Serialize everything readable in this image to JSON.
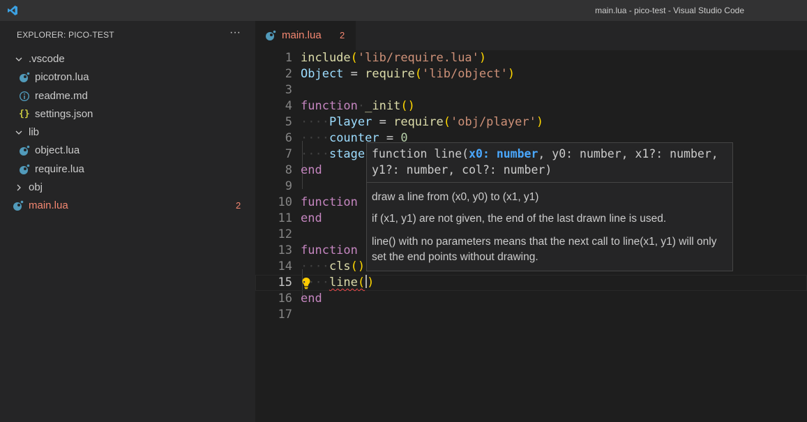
{
  "window": {
    "title": "main.lua - pico-test - Visual Studio Code"
  },
  "sidebar": {
    "header": "EXPLORER: PICO-TEST",
    "more_label": "···",
    "tree": [
      {
        "name": ".vscode",
        "kind": "folder",
        "expanded": true,
        "icon": "chevron-down-icon"
      },
      {
        "name": "picotron.lua",
        "kind": "file",
        "icon": "lua-icon"
      },
      {
        "name": "readme.md",
        "kind": "file",
        "icon": "info-icon"
      },
      {
        "name": "settings.json",
        "kind": "file",
        "icon": "json-icon"
      },
      {
        "name": "lib",
        "kind": "folder",
        "expanded": true,
        "icon": "chevron-down-icon"
      },
      {
        "name": "object.lua",
        "kind": "file",
        "icon": "lua-icon"
      },
      {
        "name": "require.lua",
        "kind": "file",
        "icon": "lua-icon"
      },
      {
        "name": "obj",
        "kind": "folder",
        "expanded": false,
        "icon": "chevron-right-icon"
      },
      {
        "name": "main.lua",
        "kind": "file",
        "icon": "lua-icon",
        "badge": "2",
        "status": "error"
      }
    ]
  },
  "editor": {
    "tab": {
      "label": "main.lua",
      "badge": "2"
    },
    "line_numbers": [
      "1",
      "2",
      "3",
      "4",
      "5",
      "6",
      "7",
      "8",
      "9",
      "10",
      "11",
      "12",
      "13",
      "14",
      "15",
      "16",
      "17"
    ],
    "current_line": "15",
    "code": {
      "l1_fn": "include",
      "l1_open": "(",
      "l1_str": "'lib/require.lua'",
      "l1_close": ")",
      "l2_var": "Object",
      "l2_eq": " = ",
      "l2_fn": "require",
      "l2_open": "(",
      "l2_str": "'lib/object'",
      "l2_close": ")",
      "l4_kw": "function",
      "l4_fn": "_init",
      "l4_parens": "()",
      "l5_var": "Player",
      "l5_eq": " = ",
      "l5_fn": "require",
      "l5_open": "(",
      "l5_str": "'obj/player'",
      "l5_close": ")",
      "l6_var": "counter",
      "l6_eq": " = ",
      "l6_num": "0",
      "l7_var": "stage",
      "l8_kw": "end",
      "l10_kw": "function",
      "l11_kw": "end",
      "l13_kw": "function",
      "l14_fn": "cls",
      "l14_parens": "()",
      "l15_fn": "line",
      "l15_open": "(",
      "l15_close": ")",
      "l16_kw": "end"
    }
  },
  "hover": {
    "sig_prefix": "function line(",
    "sig_active": "x0: number",
    "sig_rest": ", y0: number, x1?: number, y1?: number, col?: number)",
    "doc": [
      "draw a line from (x0, y0) to (x1, y1)",
      "if (x1, y1) are not given, the end of the last drawn line is used.",
      "line() with no parameters means that the next call to line(x1, y1) will only set the end points without drawing."
    ]
  },
  "colors": {
    "accent": "#007acc",
    "error": "#f48771",
    "lua_icon": "#519aba"
  }
}
